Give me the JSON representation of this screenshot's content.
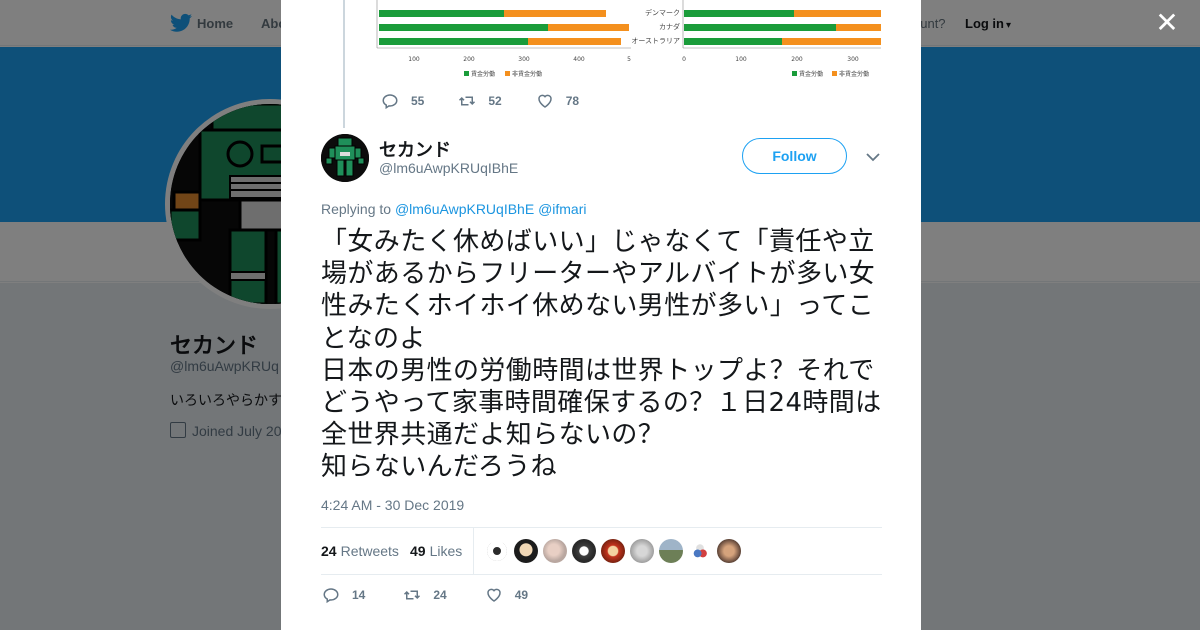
{
  "topbar": {
    "home_label": "Home",
    "about_label": "Abo",
    "account_text": "ccount?",
    "login_label": "Log in"
  },
  "profile": {
    "name": "セカンド",
    "handle": "@lm6uAwpKRUq",
    "bio": "いろいろやらかす",
    "joined": "Joined July 20"
  },
  "close_icon": "close-icon",
  "previous_tweet": {
    "chart_data": [
      {
        "type": "bar",
        "orientation": "horizontal",
        "stacked": true,
        "x_ticks": [
          "100",
          "200",
          "300",
          "400",
          "5"
        ],
        "series": [
          {
            "name": "賃金労働",
            "color": "#1a9c3a"
          },
          {
            "name": "非賃金労働",
            "color": "#f4901e"
          }
        ]
      },
      {
        "type": "bar",
        "orientation": "horizontal",
        "stacked": true,
        "categories": [
          "デンマーク",
          "カナダ",
          "オーストラリア"
        ],
        "x_ticks": [
          "0",
          "100",
          "200",
          "300"
        ],
        "series": [
          {
            "name": "賃金労働",
            "color": "#1a9c3a"
          },
          {
            "name": "非賃金労働",
            "color": "#f4901e"
          }
        ]
      }
    ],
    "replies": "55",
    "retweets": "52",
    "likes": "78"
  },
  "tweet": {
    "author_name": "セカンド",
    "author_handle": "@lm6uAwpKRUqIBhE",
    "follow_label": "Follow",
    "replying_prefix": "Replying to",
    "mention_1": "@lm6uAwpKRUqIBhE",
    "mention_2": "@ifmari",
    "text": "「女みたく休めばいい」じゃなくて「責任や立場があるからフリーターやアルバイトが多い女性みたくホイホイ休めない男性が多い」ってことなのよ\n日本の男性の労働時間は世界トップよ？それでどうやって家事時間確保するの？１日24時間は全世界共通だよ知らないの？\n知らないんだろうね",
    "timestamp": "4:24 AM - 30 Dec 2019",
    "retweet_count": "24",
    "retweets_label": "Retweets",
    "like_count": "49",
    "likes_label": "Likes",
    "replies": "14",
    "retweets": "24",
    "likes": "49"
  },
  "colors": {
    "brand_blue": "#1da1f2",
    "link_blue": "#1b95e0",
    "text_primary": "#14171a",
    "text_secondary": "#657786",
    "avatar_green": "#1f8f5a"
  }
}
